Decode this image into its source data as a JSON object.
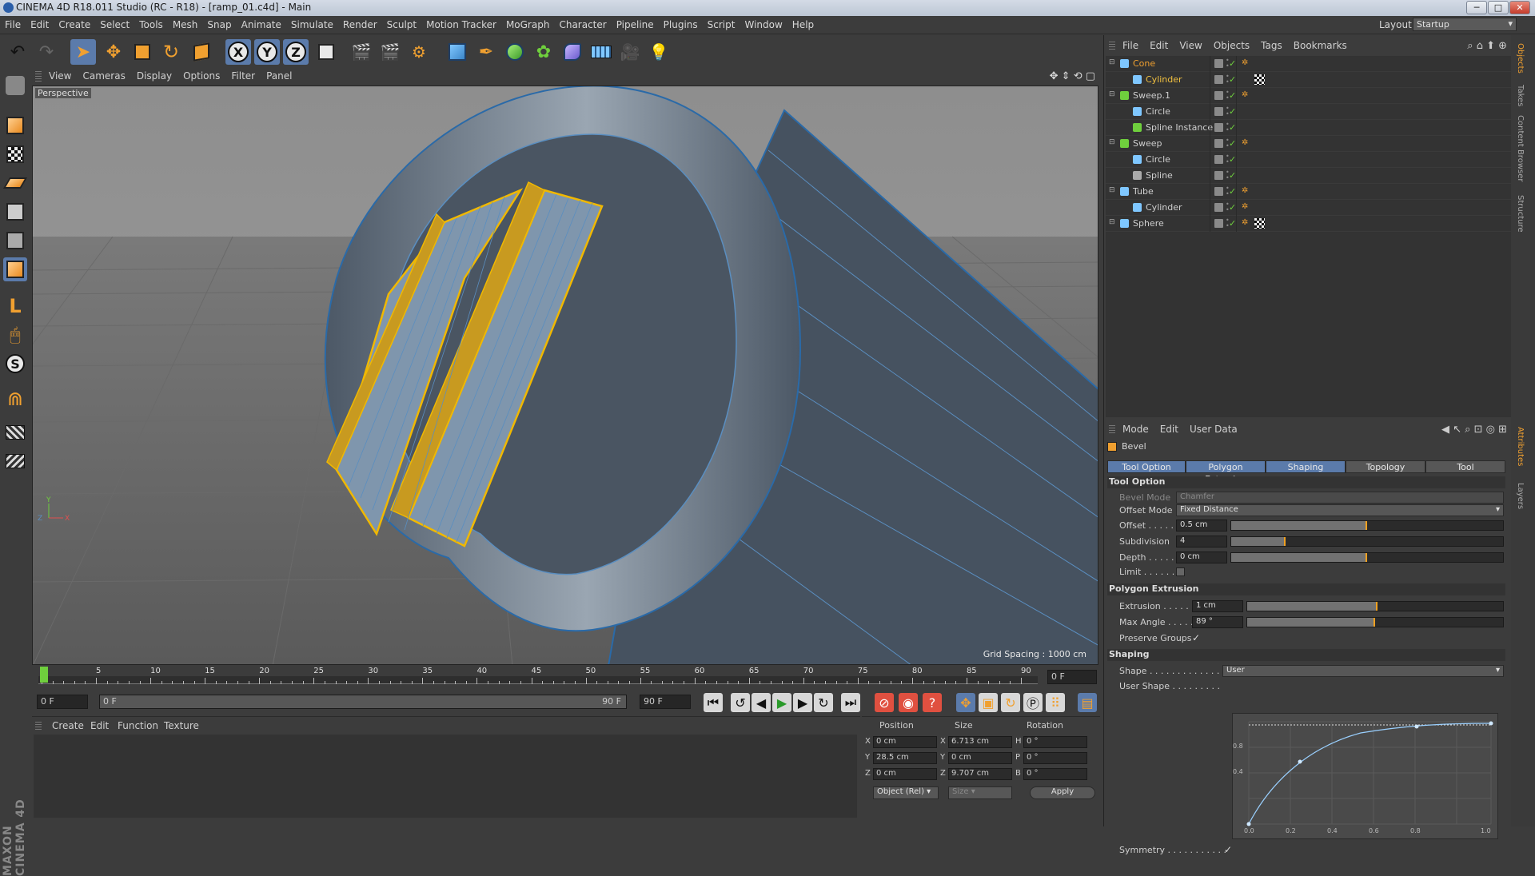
{
  "window": {
    "title": "CINEMA 4D R18.011 Studio (RC - R18) - [ramp_01.c4d] - Main",
    "min": "─",
    "max": "□",
    "close": "✕"
  },
  "menubar": {
    "items": [
      "File",
      "Edit",
      "Create",
      "Select",
      "Tools",
      "Mesh",
      "Snap",
      "Animate",
      "Simulate",
      "Render",
      "Sculpt",
      "Motion Tracker",
      "MoGraph",
      "Character",
      "Pipeline",
      "Plugins",
      "Script",
      "Window",
      "Help"
    ],
    "layout_label": "Layout:",
    "layout_value": "Startup"
  },
  "toolbar": {
    "x": "X",
    "y": "Y",
    "z": "Z"
  },
  "left_tools": {
    "s_label": "S"
  },
  "branding": "MAXON CINEMA 4D",
  "viewport": {
    "menu": [
      "View",
      "Cameras",
      "Display",
      "Options",
      "Filter",
      "Panel"
    ],
    "camera": "Perspective",
    "grid_spacing": "Grid Spacing : 1000 cm"
  },
  "timeline": {
    "ticks": [
      "0",
      "5",
      "10",
      "15",
      "20",
      "25",
      "30",
      "35",
      "40",
      "45",
      "50",
      "55",
      "60",
      "65",
      "70",
      "75",
      "80",
      "85",
      "90"
    ],
    "end_field": "0 F"
  },
  "playback": {
    "start": "0 F",
    "range_start": "0 F",
    "range_end": "90 F",
    "end": "90 F"
  },
  "material": {
    "menu": [
      "Create",
      "Edit",
      "Function",
      "Texture"
    ]
  },
  "coords": {
    "headers": [
      "Position",
      "Size",
      "Rotation"
    ],
    "rows": [
      {
        "axis": "X",
        "pos": "0 cm",
        "size_axis": "X",
        "size": "6.713 cm",
        "rot_axis": "H",
        "rot": "0 °"
      },
      {
        "axis": "Y",
        "pos": "28.5 cm",
        "size_axis": "Y",
        "size": "0 cm",
        "rot_axis": "P",
        "rot": "0 °"
      },
      {
        "axis": "Z",
        "pos": "0 cm",
        "size_axis": "Z",
        "size": "9.707 cm",
        "rot_axis": "B",
        "rot": "0 °"
      }
    ],
    "mode": "Object (Rel)",
    "size_mode": "Size",
    "apply": "Apply"
  },
  "objects": {
    "menu": [
      "File",
      "Edit",
      "View",
      "Objects",
      "Tags",
      "Bookmarks"
    ],
    "list": [
      {
        "name": "Cone",
        "indent": 0,
        "color": "#f0a030",
        "icon": "#7fc7ff"
      },
      {
        "name": "Cylinder",
        "indent": 1,
        "color": "#f0c040",
        "icon": "#7fc7ff"
      },
      {
        "name": "Sweep.1",
        "indent": 0,
        "color": "#cfcfcf",
        "icon": "#6fcf3d"
      },
      {
        "name": "Circle",
        "indent": 1,
        "color": "#cfcfcf",
        "icon": "#7fc7ff"
      },
      {
        "name": "Spline Instance",
        "indent": 1,
        "color": "#cfcfcf",
        "icon": "#6fcf3d"
      },
      {
        "name": "Sweep",
        "indent": 0,
        "color": "#cfcfcf",
        "icon": "#6fcf3d"
      },
      {
        "name": "Circle",
        "indent": 1,
        "color": "#cfcfcf",
        "icon": "#7fc7ff"
      },
      {
        "name": "Spline",
        "indent": 1,
        "color": "#cfcfcf",
        "icon": "#aaaaaa"
      },
      {
        "name": "Tube",
        "indent": 0,
        "color": "#cfcfcf",
        "icon": "#7fc7ff"
      },
      {
        "name": "Cylinder",
        "indent": 1,
        "color": "#cfcfcf",
        "icon": "#7fc7ff"
      },
      {
        "name": "Sphere",
        "indent": 0,
        "color": "#cfcfcf",
        "icon": "#7fc7ff"
      }
    ]
  },
  "attributes": {
    "menu": [
      "Mode",
      "Edit",
      "User Data"
    ],
    "tool_name": "Bevel",
    "tabs": [
      "Tool Option",
      "Polygon Extrusion",
      "Shaping",
      "Topology",
      "Tool"
    ],
    "tool_option": {
      "title": "Tool Option",
      "bevel_mode_label": "Bevel Mode",
      "bevel_mode": "Chamfer",
      "offset_mode_label": "Offset Mode",
      "offset_mode": "Fixed Distance",
      "offset_label": "Offset . . . . .",
      "offset": "0.5 cm",
      "offset_fill": 0.5,
      "subdivision_label": "Subdivision",
      "subdivision": "4",
      "subdivision_fill": 0.2,
      "depth_label": "Depth . . . . .",
      "depth": "0 cm",
      "depth_fill": 0.5,
      "limit_label": "Limit . . . . . ."
    },
    "polygon_extrusion": {
      "title": "Polygon Extrusion",
      "extrusion_label": "Extrusion . . . . . .",
      "extrusion": "1 cm",
      "extrusion_fill": 0.51,
      "max_angle_label": "Max Angle . . . . .",
      "max_angle": "89 °",
      "max_angle_fill": 0.5,
      "preserve_label": "Preserve Groups",
      "preserve_check": "✓"
    },
    "shaping": {
      "title": "Shaping",
      "shape_label": "Shape . . . . . . . . . . . . . .",
      "shape": "User",
      "user_shape_label": "User Shape . . . . . . . . .",
      "y_ticks": [
        "0.8",
        "0.4"
      ],
      "x_ticks": [
        "0.0",
        "0.2",
        "0.4",
        "0.6",
        "0.8",
        "1.0"
      ],
      "symmetry_label": "Symmetry . . . . . . . . . . .",
      "symmetry_check": "✓"
    }
  },
  "side_tabs": [
    "Objects",
    "Takes",
    "Content Browser",
    "Structure",
    "Attributes",
    "Layers"
  ]
}
